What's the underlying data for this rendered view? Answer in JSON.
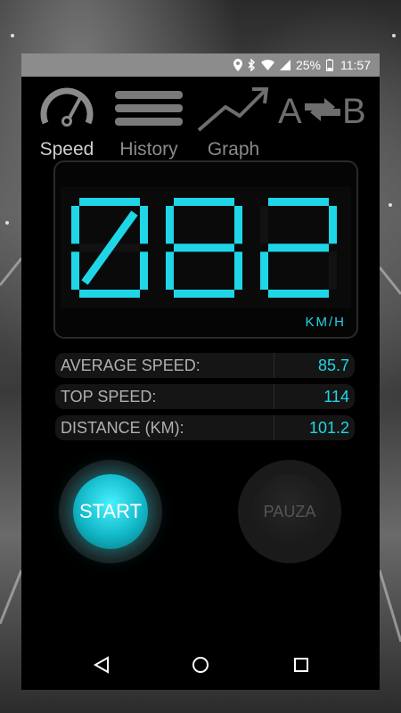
{
  "status_bar": {
    "battery": "25%",
    "time": "11:57",
    "icons": [
      "location-icon",
      "bluetooth-icon",
      "wifi-icon",
      "signal-icon",
      "battery-icon"
    ]
  },
  "tabs": [
    {
      "label": "Speed",
      "icon": "speedometer-icon",
      "active": true
    },
    {
      "label": "History",
      "icon": "hamburger-icon",
      "active": false
    },
    {
      "label": "Graph",
      "icon": "trend-icon",
      "active": false
    },
    {
      "label": "",
      "icon": "a-swap-b-icon",
      "active": false
    }
  ],
  "speed": {
    "digits": "082",
    "unit": "KM/H"
  },
  "stats": [
    {
      "label": "AVERAGE SPEED:",
      "value": "85.7"
    },
    {
      "label": "TOP SPEED:",
      "value": "114"
    },
    {
      "label": "DISTANCE (KM):",
      "value": "101.2"
    }
  ],
  "buttons": {
    "start": "START",
    "pause": "PAUZA"
  },
  "navbar": {
    "icons": [
      "back-icon",
      "home-icon",
      "recents-icon"
    ]
  },
  "colors": {
    "accent": "#1fd6e6",
    "status_bar": "#8c8c8c",
    "background": "#000000"
  }
}
